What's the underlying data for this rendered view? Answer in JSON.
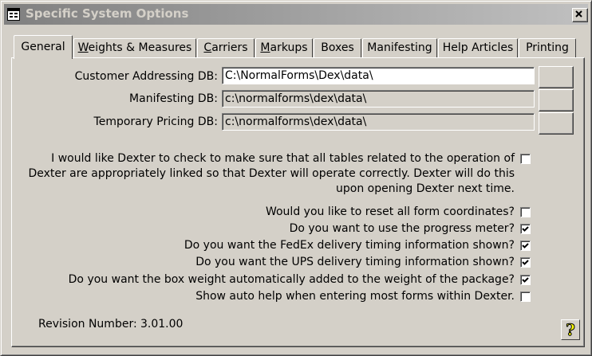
{
  "window": {
    "title": "Specific System Options",
    "close_glyph": "✕"
  },
  "tabs": [
    {
      "label": "General",
      "active": true
    },
    {
      "label": "Weights & Measures",
      "accel": "W",
      "rest": "eights & Measures"
    },
    {
      "label": "Carriers",
      "accel": "C",
      "rest": "arriers"
    },
    {
      "label": "Markups",
      "accel": "M",
      "rest": "arkups"
    },
    {
      "label": "Boxes"
    },
    {
      "label": "Manifesting"
    },
    {
      "label": "Help Articles"
    },
    {
      "label": "Printing"
    }
  ],
  "paths": [
    {
      "label": "Customer Addressing DB:",
      "value": "C:\\NormalForms\\Dex\\data\\"
    },
    {
      "label": "Manifesting DB:",
      "value": "c:\\normalforms\\dex\\data\\"
    },
    {
      "label": "Temporary Pricing DB:",
      "value": "c:\\normalforms\\dex\\data\\"
    }
  ],
  "link_check": {
    "line1": "I would like Dexter to check to make sure that all tables related to the operation of",
    "line2": "Dexter are appropriately linked so that Dexter will operate correctly. Dexter will do this",
    "line3": "upon opening Dexter next time.",
    "checked": false
  },
  "options": [
    {
      "label": "Would you like to reset all form coordinates?",
      "checked": false
    },
    {
      "label": "Do you want to use the progress meter?",
      "checked": true
    },
    {
      "label": "Do you want the FedEx delivery timing information shown?",
      "checked": true
    },
    {
      "label": "Do you want the UPS delivery timing information shown?",
      "checked": true
    },
    {
      "label": "Do you want the box weight automatically added to the weight of the package?",
      "checked": true
    },
    {
      "label": "Show auto help when entering most forms within Dexter.",
      "checked": false
    }
  ],
  "revision": {
    "label": "Revision Number:",
    "value": "3.01.00"
  },
  "help_glyph": "?",
  "colors": {
    "face": "#d4d0c8",
    "title_start": "#808080",
    "title_end": "#c0c0c0",
    "help_yellow": "#ffff00"
  }
}
